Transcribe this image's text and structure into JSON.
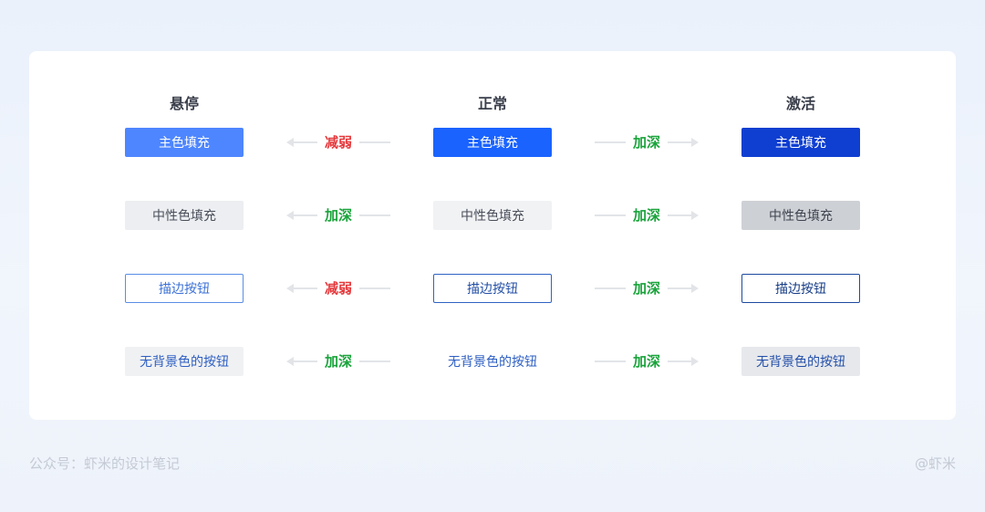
{
  "columns": {
    "hover": "悬停",
    "normal": "正常",
    "active": "激活"
  },
  "rows": [
    {
      "button_label": "主色填充",
      "left_change": "减弱",
      "right_change": "加深"
    },
    {
      "button_label": "中性色填充",
      "left_change": "加深",
      "right_change": "加深"
    },
    {
      "button_label": "描边按钮",
      "left_change": "减弱",
      "right_change": "加深"
    },
    {
      "button_label": "无背景色的按钮",
      "left_change": "加深",
      "right_change": "加深"
    }
  ],
  "colors": {
    "weaken": "#e5383b",
    "deepen": "#1aa33b",
    "primary_normal": "#1a63ff"
  },
  "footer": {
    "left": "公众号：虾米的设计笔记",
    "right": "@虾米"
  }
}
